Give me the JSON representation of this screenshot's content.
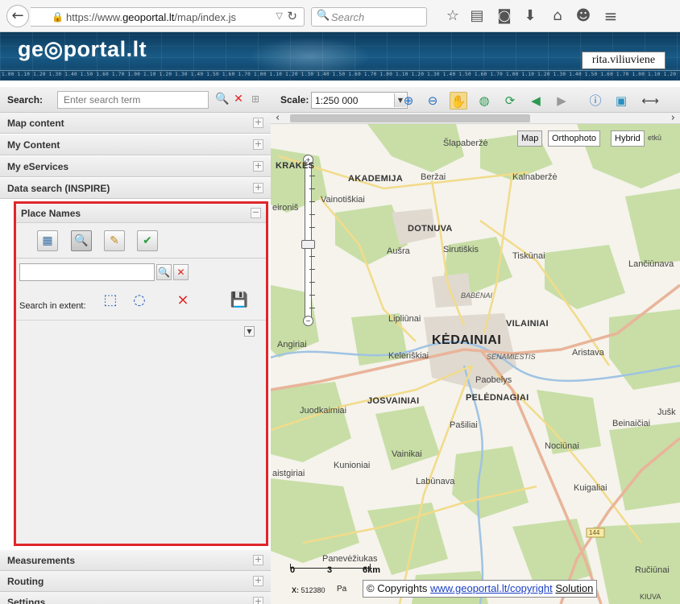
{
  "browser": {
    "back_icon": "back-arrow-icon",
    "url_prefix": "https://www.",
    "url_domain": "geoportal.lt",
    "url_path": "/map/index.js",
    "search_placeholder": "Search",
    "icons": [
      "star-icon",
      "reading-list-icon",
      "pocket-icon",
      "download-icon",
      "home-icon",
      "chat-icon",
      "menu-icon"
    ]
  },
  "banner": {
    "logo": "ge◎portal.lt",
    "user": "rita.viliuviene",
    "ruler": "1.00 1.10 1.20 1.30 1.40 1.50 1.60 1.70 1.00 1.10 1.20 1.30 1.40 1.50 1.60 1.70 1.00 1.10 1.20 1.30 1.40 1.50 1.60 1.70 1.00 1.10 1.20 1.30 1.40 1.50 1.60 1.70 1.00 1.10 1.20 1.30 1.40 1.50 1.60 1.70 1.00 1.10 1.20 1.30 1.40 1.50 1.60 1.70 1.00 1.10 1.20 1.30 1.40 1.50 1.60 1.70"
  },
  "search": {
    "label": "Search:",
    "placeholder": "Enter search term"
  },
  "accordion": {
    "map_content": "Map content",
    "my_content": "My Content",
    "my_eservices": "My eServices",
    "data_search": "Data search (INSPIRE)",
    "measurements": "Measurements",
    "routing": "Routing",
    "settings": "Settings",
    "expand": "+",
    "collapse": "−"
  },
  "place_names": {
    "title": "Place Names",
    "extent_label": "Search in extent:",
    "input_value": ""
  },
  "map_toolbar": {
    "scale_label": "Scale:",
    "scale_value": "1:250 000"
  },
  "map": {
    "layers": [
      "Map",
      "Orthophoto",
      "Hybrid"
    ],
    "active_layer": "Map",
    "partial_label": "etkū",
    "places": {
      "krakes": "KRAKĖS",
      "slapaberze": "Šlapaberžė",
      "akademija": "AKADEMIJA",
      "berzai": "Beržai",
      "kalnaberze": "Kalnaberžė",
      "vainotiskiai": "Vainotiškiai",
      "eironis": "eironiš",
      "dotnuva": "DOTNUVA",
      "ausra": "Aušra",
      "sirutiskis": "Sirutiškis",
      "tiskunai": "Tiskūnai",
      "lanciunava": "Lančiūnava",
      "babenai": "BABĖNAI",
      "liplunai": "Lipliūnai",
      "vilainiai": "VILAINIAI",
      "angiriai": "Angiriai",
      "kedainiai": "KĖDAINIAI",
      "keleriskiai": "Keleriškiai",
      "senamiestis": "SENAMIESTIS",
      "aristava": "Aristava",
      "paobelys": "Paobelys",
      "juodkaimiai": "Juodkaimiai",
      "josvainiai": "JOSVAINIAI",
      "pelednagiai": "PELĖDNAGIAI",
      "beinaiciai": "Beinaičiai",
      "jusk": "Jušk",
      "pasiliai": "Pašiliai",
      "nociunai": "Nociūnai",
      "vainikai": "Vainikai",
      "kunioniai": "Kunioniai",
      "aistgiriai": "aistgiriai",
      "labunava": "Labūnava",
      "kuigaliai": "Kuigaliai",
      "panevezukas": "Panevėžiukas",
      "ruciunai": "Ručiūnai",
      "kiuva": "KIUVA",
      "road_number": "144"
    },
    "scale_ticks": [
      "0",
      "3",
      "6km"
    ],
    "coord_label": "X:",
    "coord_value": "512380",
    "pa_label": "Pa",
    "copyright_prefix": "© Copyrights",
    "copyright_link": "www.geoportal.lt/copyright",
    "solution_link": "Solution"
  },
  "colors": {
    "highlight_border": "#e0262b",
    "banner_bg": "#185a85",
    "forest": "#c8dea6",
    "road_major": "#e9b49a",
    "road_minor": "#f2db8a",
    "water": "#9fc3e3",
    "urban": "#e0d9d0"
  }
}
